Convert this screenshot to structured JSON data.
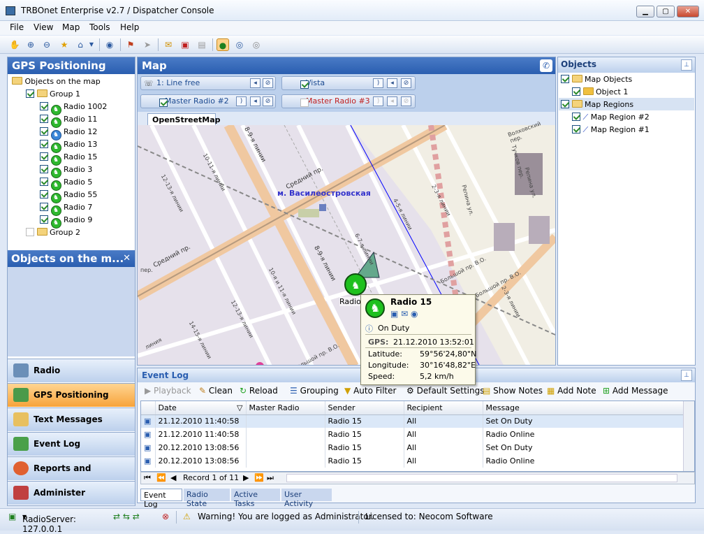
{
  "window": {
    "title": "TRBOnet Enterprise v2.7 / Dispatcher Console"
  },
  "menu": [
    "File",
    "View",
    "Map",
    "Tools",
    "Help"
  ],
  "left": {
    "title": "GPS Positioning",
    "tree_root": "Objects on the map",
    "group1": "Group 1",
    "radios": [
      "Radio 1002",
      "Radio 11",
      "Radio 12",
      "Radio 13",
      "Radio 15",
      "Radio 3",
      "Radio 5",
      "Radio 55",
      "Radio 7",
      "Radio 9"
    ],
    "group2": "Group 2",
    "sub_title": "Objects on the m...",
    "sub_close": "✕"
  },
  "nav": [
    "Radio",
    "GPS Positioning",
    "Text Messages",
    "Event Log",
    "Reports and Statistics",
    "Administer"
  ],
  "map": {
    "title": "Map",
    "channels": [
      "1: Line free",
      "Vista",
      "Master Radio #2",
      "Master Radio #3"
    ],
    "tab": "OpenStreetMap",
    "metro": "м. Василеостровская",
    "streets": [
      "Средний пр.",
      "Средний пр.",
      "8-9-я линии",
      "8-9-я линии",
      "10-11-я линии",
      "12-13-я линии",
      "10-я и 11-я линии",
      "12-13-я линии",
      "14-15-я линии",
      "6-7-я линии",
      "4-5-я линии",
      "2-3-я линии",
      "Репина ул.",
      "Репина ул.",
      "Большой пр. В.О.",
      "Большой пр. В.О.",
      "2-3-я линии",
      "линия",
      "Тучков пер.",
      "Волховский пер.",
      "Большой пр. В.О.",
      "пер."
    ],
    "marker_label": "Radio",
    "popup": {
      "name": "Radio 15",
      "status": "On Duty",
      "gps_label": "GPS:",
      "gps_time": "21.12.2010 13:52:01",
      "lat_label": "Latitude:",
      "lat": "59°56'24,80\"N",
      "lon_label": "Longitude:",
      "lon": "30°16'48,82\"E",
      "speed_label": "Speed:",
      "speed": "5,2 km/h"
    }
  },
  "objects": {
    "title": "Objects",
    "items": [
      "Map Objects",
      "Object 1",
      "Map Regions",
      "Map Region #2",
      "Map Region #1"
    ]
  },
  "eventlog": {
    "title": "Event Log",
    "toolbar": [
      "Playback",
      "Clean",
      "Reload",
      "Grouping",
      "Auto Filter",
      "Default Settings",
      "Show Notes",
      "Add Note",
      "Add Message"
    ],
    "columns": [
      "Date",
      "Master Radio",
      "Sender",
      "Recipient",
      "Message"
    ],
    "rows": [
      [
        "21.12.2010 11:40:58",
        "",
        "Radio 15",
        "All",
        "Set On Duty"
      ],
      [
        "21.12.2010 11:40:58",
        "",
        "Radio 15",
        "All",
        "Radio Online"
      ],
      [
        "20.12.2010 13:08:56",
        "",
        "Radio 15",
        "All",
        "Set On Duty"
      ],
      [
        "20.12.2010 13:08:56",
        "",
        "Radio 15",
        "All",
        "Radio Online"
      ]
    ],
    "record": "Record 1 of 11",
    "tabs": [
      "Event Log",
      "Radio State",
      "Active Tasks",
      "User Activity"
    ]
  },
  "status": {
    "server": "RadioServer: 127.0.0.1",
    "warning": "Warning! You are logged as Administrator.",
    "license": "Licensed to: Neocom Software"
  }
}
